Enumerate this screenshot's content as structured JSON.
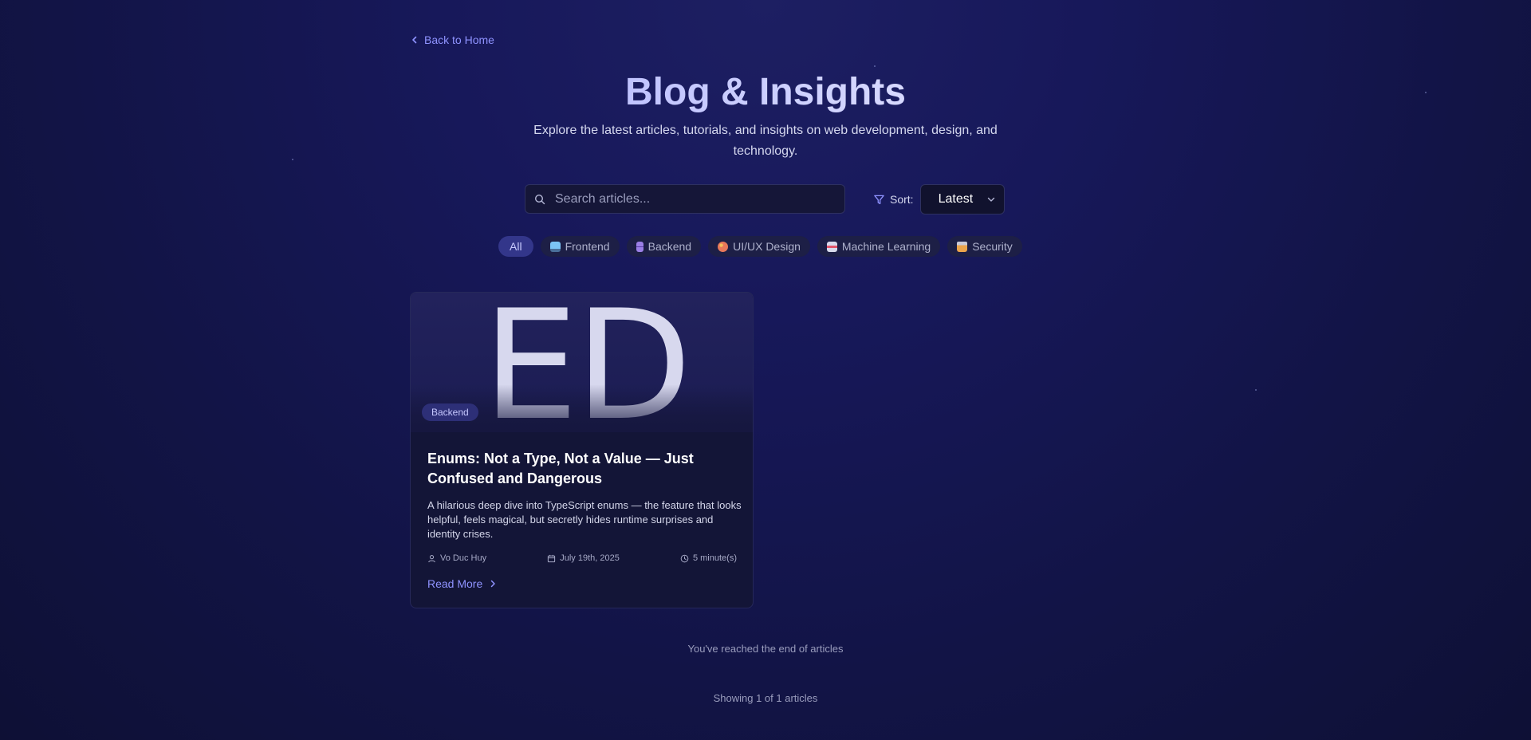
{
  "nav": {
    "back_label": "Back to Home"
  },
  "hero": {
    "title": "Blog & Insights",
    "subtitle": "Explore the latest articles, tutorials, and insights on web development, design, and technology."
  },
  "search": {
    "placeholder": "Search articles...",
    "value": ""
  },
  "sort": {
    "label": "Sort:",
    "selected": "Latest"
  },
  "categories": [
    {
      "label": "All",
      "icon": "",
      "active": true
    },
    {
      "label": "Frontend",
      "icon": "monitor-icon",
      "color": "#5fa8e8"
    },
    {
      "label": "Backend",
      "icon": "server-icon",
      "color": "#8a6fd6"
    },
    {
      "label": "UI/UX Design",
      "icon": "palette-icon",
      "color": "#e88f6a"
    },
    {
      "label": "Machine Learning",
      "icon": "robot-icon",
      "color": "#c9cbe0"
    },
    {
      "label": "Security",
      "icon": "lock-icon",
      "color": "#e0a04c"
    }
  ],
  "articles": [
    {
      "cover_text": "ED",
      "tag": "Backend",
      "title": "Enums: Not a Type, Not a Value — Just Confused and Dangerous",
      "excerpt": "A hilarious deep dive into TypeScript enums — the feature that looks helpful, feels magical, but secretly hides runtime surprises and identity crises.",
      "author": "Vo Duc Huy",
      "date": "July 19th, 2025",
      "read_time": "5 minute(s)",
      "read_more": "Read More"
    }
  ],
  "footer": {
    "end_message": "You've reached the end of articles",
    "count_message": "Showing 1 of 1 articles"
  },
  "colors": {
    "accent": "#8f93ff",
    "background": "#17185a"
  }
}
